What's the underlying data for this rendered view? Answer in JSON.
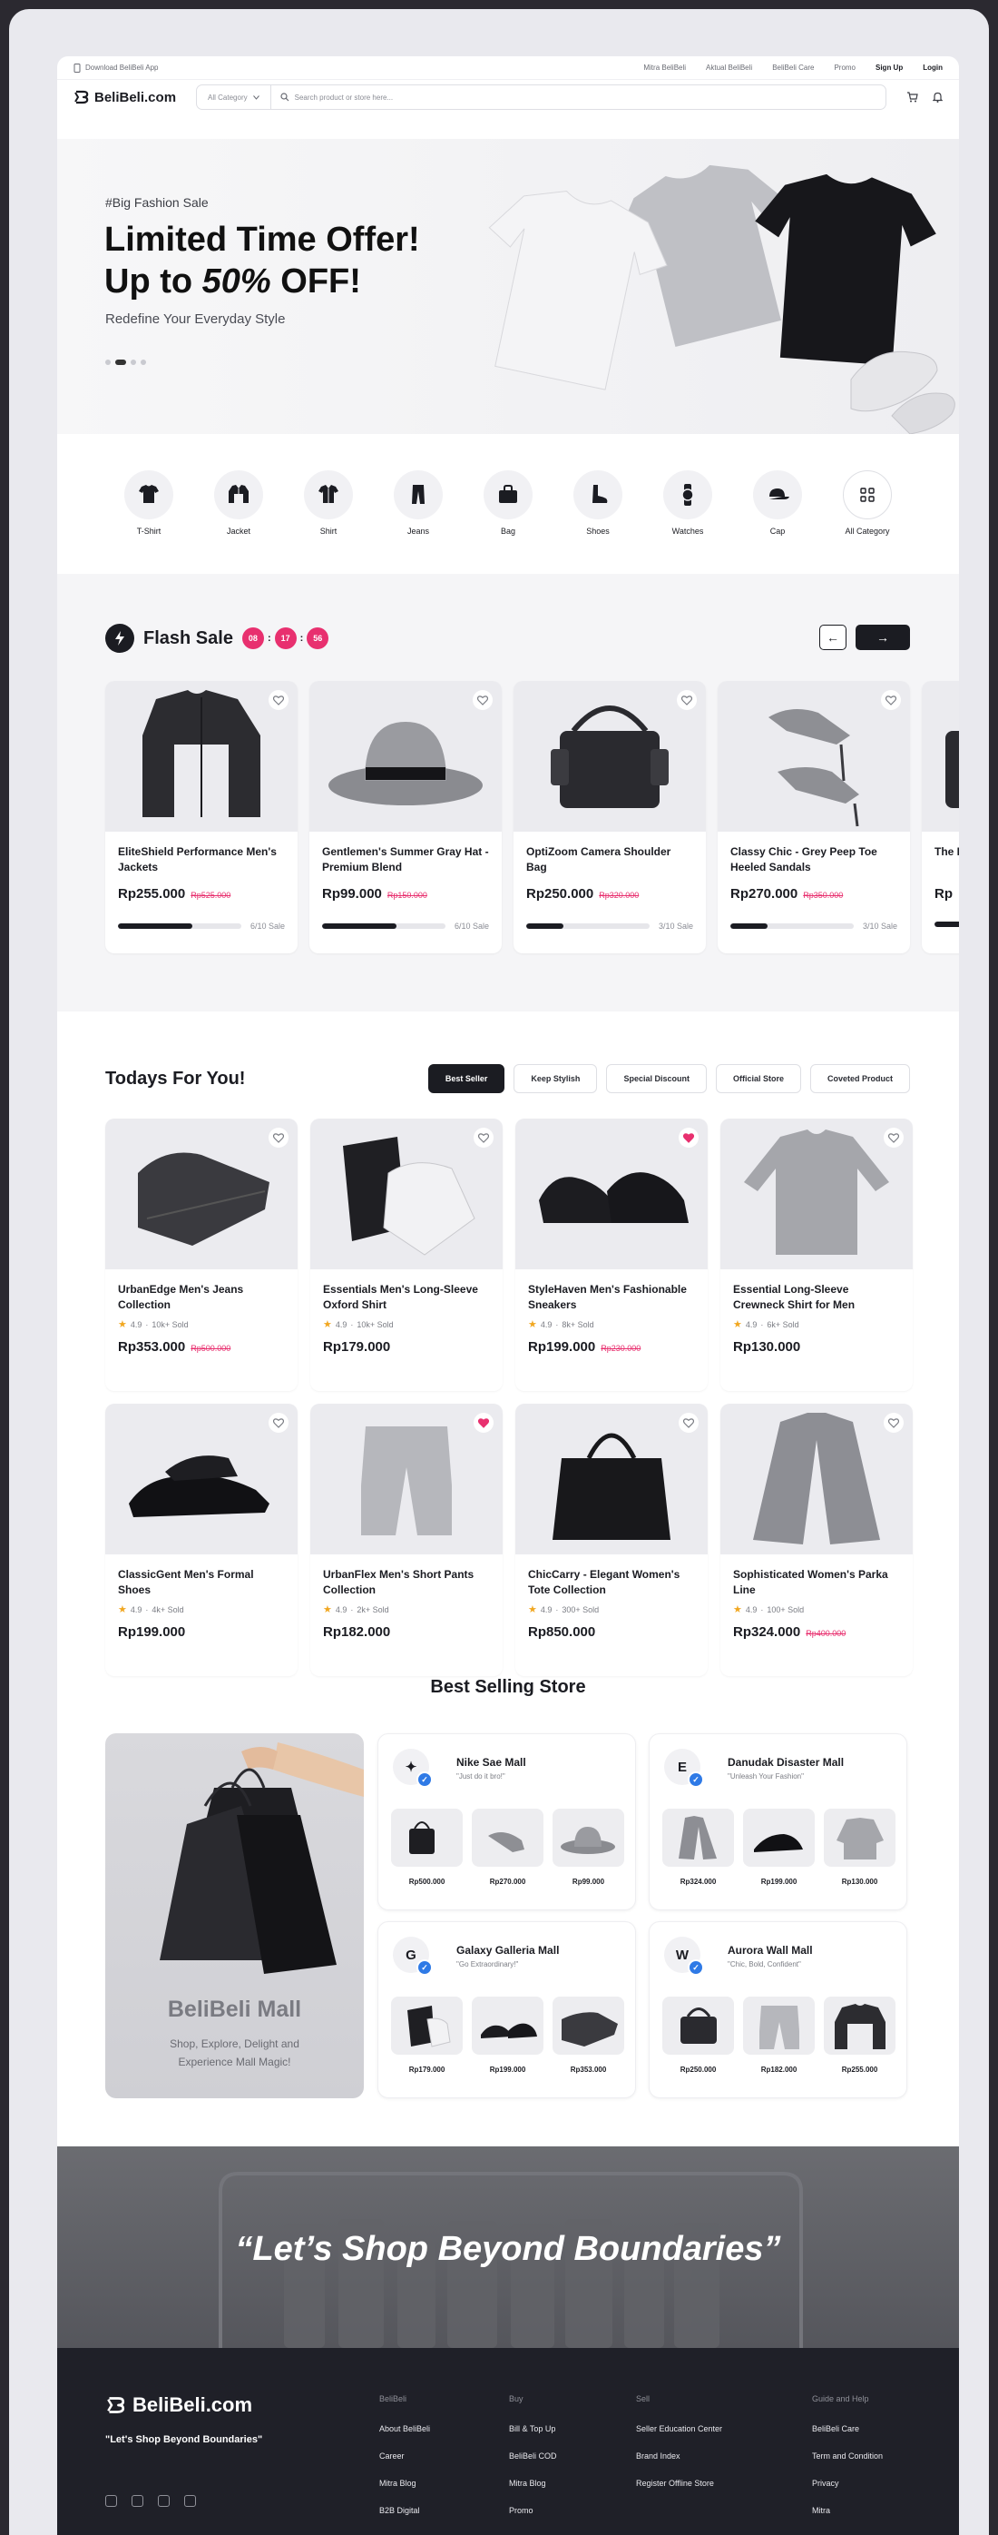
{
  "topbar": {
    "left": "Download BeliBeli App",
    "links": [
      "Mitra BeliBeli",
      "Aktual BeliBeli",
      "BeliBeli Care",
      "Promo"
    ],
    "signup": "Sign Up",
    "login": "Login"
  },
  "navbar": {
    "brand": "BeliBeli.com",
    "category": "All Category",
    "search_placeholder": "Search product or store here..."
  },
  "hero": {
    "subtitle": "#Big Fashion Sale",
    "title_line1": "Limited Time Offer!",
    "title_line2_prefix": "Up to ",
    "title_line2_highlight": "50%",
    "title_line2_suffix": " OFF!",
    "tagline": "Redefine Your Everyday Style"
  },
  "categories": [
    {
      "label": "T-Shirt",
      "icon": "tshirt-icon"
    },
    {
      "label": "Jacket",
      "icon": "jacket-icon"
    },
    {
      "label": "Shirt",
      "icon": "shirt-icon"
    },
    {
      "label": "Jeans",
      "icon": "jeans-icon"
    },
    {
      "label": "Bag",
      "icon": "bag-icon"
    },
    {
      "label": "Shoes",
      "icon": "shoes-icon"
    },
    {
      "label": "Watches",
      "icon": "watch-icon"
    },
    {
      "label": "Cap",
      "icon": "cap-icon"
    },
    {
      "label": "All Category",
      "icon": "grid-icon"
    }
  ],
  "flash_sale": {
    "title": "Flash Sale",
    "timer": [
      "08",
      "17",
      "56"
    ],
    "products": [
      {
        "name": "EliteShield Performance Men's Jackets",
        "price": "Rp255.000",
        "old": "Rp525.000",
        "sold": "6/10 Sale",
        "progress": 0.6
      },
      {
        "name": "Gentlemen's Summer Gray Hat - Premium Blend",
        "price": "Rp99.000",
        "old": "Rp150.000",
        "sold": "6/10 Sale",
        "progress": 0.6
      },
      {
        "name": "OptiZoom Camera Shoulder Bag",
        "price": "Rp250.000",
        "old": "Rp320.000",
        "sold": "3/10 Sale",
        "progress": 0.3
      },
      {
        "name": "Classy Chic - Grey Peep Toe Heeled Sandals",
        "price": "Rp270.000",
        "old": "Rp350.000",
        "sold": "3/10 Sale",
        "progress": 0.3
      },
      {
        "name": "The Pre",
        "price": "Rp",
        "old": "",
        "sold": "",
        "progress": 0.5
      }
    ]
  },
  "todays": {
    "title": "Todays For You!",
    "filters": [
      "Best Seller",
      "Keep Stylish",
      "Special Discount",
      "Official Store",
      "Coveted Product"
    ],
    "products": [
      {
        "name": "UrbanEdge Men's Jeans Collection",
        "rating": "4.9",
        "sold": "10k+ Sold",
        "price": "Rp353.000",
        "old": "Rp500.000",
        "liked": false
      },
      {
        "name": "Essentials Men's Long-Sleeve Oxford Shirt",
        "rating": "4.9",
        "sold": "10k+ Sold",
        "price": "Rp179.000",
        "old": "",
        "liked": false
      },
      {
        "name": "StyleHaven Men's Fashionable Sneakers",
        "rating": "4.9",
        "sold": "8k+ Sold",
        "price": "Rp199.000",
        "old": "Rp230.000",
        "liked": true
      },
      {
        "name": "Essential Long-Sleeve Crewneck Shirt for Men",
        "rating": "4.9",
        "sold": "6k+ Sold",
        "price": "Rp130.000",
        "old": "",
        "liked": false
      },
      {
        "name": "ClassicGent Men's Formal Shoes",
        "rating": "4.9",
        "sold": "4k+ Sold",
        "price": "Rp199.000",
        "old": "",
        "liked": false
      },
      {
        "name": "UrbanFlex Men's Short Pants Collection",
        "rating": "4.9",
        "sold": "2k+ Sold",
        "price": "Rp182.000",
        "old": "",
        "liked": true
      },
      {
        "name": "ChicCarry - Elegant Women's Tote Collection",
        "rating": "4.9",
        "sold": "300+ Sold",
        "price": "Rp850.000",
        "old": "",
        "liked": false
      },
      {
        "name": "Sophisticated Women's Parka Line",
        "rating": "4.9",
        "sold": "100+ Sold",
        "price": "Rp324.000",
        "old": "Rp400.000",
        "liked": false
      }
    ]
  },
  "stores": {
    "title": "Best Selling Store",
    "mall_title": "BeliBeli Mall",
    "mall_desc": "Shop, Explore, Delight and Experience Mall Magic!",
    "list": [
      {
        "name": "Nike Sae Mall",
        "slogan": "\"Just do it bro!\"",
        "prices": [
          "Rp500.000",
          "Rp270.000",
          "Rp99.000"
        ]
      },
      {
        "name": "Danudak Disaster Mall",
        "slogan": "\"Unleash Your Fashion\"",
        "prices": [
          "Rp324.000",
          "Rp199.000",
          "Rp130.000"
        ]
      },
      {
        "name": "Galaxy Galleria Mall",
        "slogan": "\"Go Extraordinary!\"",
        "prices": [
          "Rp179.000",
          "Rp199.000",
          "Rp353.000"
        ]
      },
      {
        "name": "Aurora Wall Mall",
        "slogan": "\"Chic, Bold, Confident\"",
        "prices": [
          "Rp250.000",
          "Rp182.000",
          "Rp255.000"
        ]
      }
    ]
  },
  "banner": {
    "quote": "“Let’s Shop Beyond Boundaries”"
  },
  "footer": {
    "brand": "BeliBeli.com",
    "slogan": "\"Let's Shop Beyond Boundaries\"",
    "columns": [
      {
        "title": "BeliBeli",
        "links": [
          "About BeliBeli",
          "Career",
          "Mitra Blog",
          "B2B Digital"
        ]
      },
      {
        "title": "Buy",
        "links": [
          "Bill & Top Up",
          "BeliBeli COD",
          "Mitra Blog",
          "Promo"
        ]
      },
      {
        "title": "Sell",
        "links": [
          "Seller Education Center",
          "Brand Index",
          "Register Offline Store"
        ]
      },
      {
        "title": "Guide and Help",
        "links": [
          "BeliBeli Care",
          "Term and Condition",
          "Privacy",
          "Mitra"
        ]
      }
    ]
  },
  "colors": {
    "accent": "#e8306f",
    "dark": "#1b1c22",
    "footer": "#1f2028"
  }
}
